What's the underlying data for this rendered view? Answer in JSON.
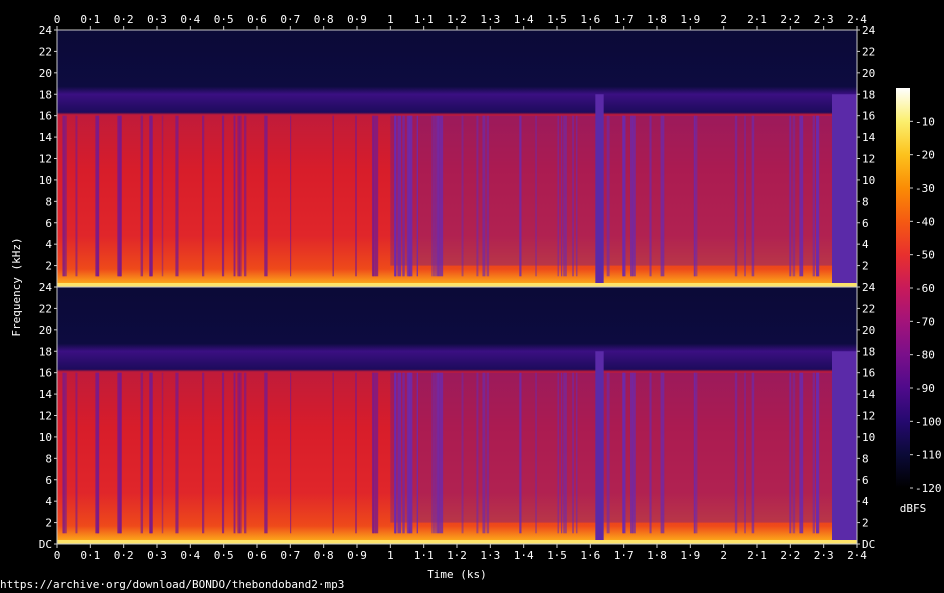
{
  "chart_data": {
    "type": "heatmap",
    "title": "",
    "xlabel": "Time (ks)",
    "ylabel": "Frequency (kHz)",
    "x_ticks": [
      "0",
      "0·1",
      "0·2",
      "0·3",
      "0·4",
      "0·5",
      "0·6",
      "0·7",
      "0·8",
      "0·9",
      "1",
      "1·1",
      "1·2",
      "1·3",
      "1·4",
      "1·5",
      "1·6",
      "1·7",
      "1·8",
      "1·9",
      "2",
      "2·1",
      "2·2",
      "2·3",
      "2·4"
    ],
    "x_range": [
      0,
      2.4
    ],
    "channels": [
      {
        "y_ticks": [
          "24",
          "22",
          "20",
          "18",
          "16",
          "14",
          "12",
          "10",
          "8",
          "6",
          "4",
          "2"
        ]
      },
      {
        "y_ticks": [
          "24",
          "22",
          "20",
          "18",
          "16",
          "14",
          "12",
          "10",
          "8",
          "6",
          "4",
          "2",
          "DC"
        ]
      }
    ],
    "y_range_khz": [
      0,
      24
    ],
    "lowpass_cutoff_khz": 16,
    "colorbar": {
      "label": "dBFS",
      "ticks": [
        "-10",
        "-20",
        "-30",
        "-40",
        "-50",
        "-60",
        "-70",
        "-80",
        "-90",
        "-100",
        "-110",
        "-120"
      ],
      "range_dbfs": [
        -120,
        0
      ],
      "colors": [
        "#000000",
        "#0b0a37",
        "#25096f",
        "#4f0a8b",
        "#7a0f8a",
        "#a3137a",
        "#c81a5a",
        "#e8302e",
        "#f55a12",
        "#fb8c05",
        "#fcc21d",
        "#fbef6e",
        "#ffffff"
      ]
    },
    "quiet_segments_ks": [
      [
        1.615,
        1.64
      ],
      [
        2.325,
        2.4
      ]
    ]
  },
  "source_url": "https://archive·org/download/BONDO/thebondoband2·mp3"
}
